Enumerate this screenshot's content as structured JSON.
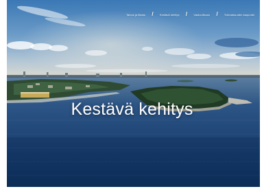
{
  "nav": {
    "items": [
      {
        "label": "Talous ja tilasto"
      },
      {
        "label": "Kestävä kehitys"
      },
      {
        "label": "Vastuullisuus"
      },
      {
        "label": "Tulevaisuuden kaupunki"
      }
    ]
  },
  "hero": {
    "title": "Kestävä kehitys",
    "image_alt": "aerial-photo-city-coast-sea"
  },
  "colors": {
    "sky_top": "#3d7ab6",
    "sky_horizon": "#d9d9d0",
    "sea": "#123a6c",
    "text": "#ffffff"
  }
}
